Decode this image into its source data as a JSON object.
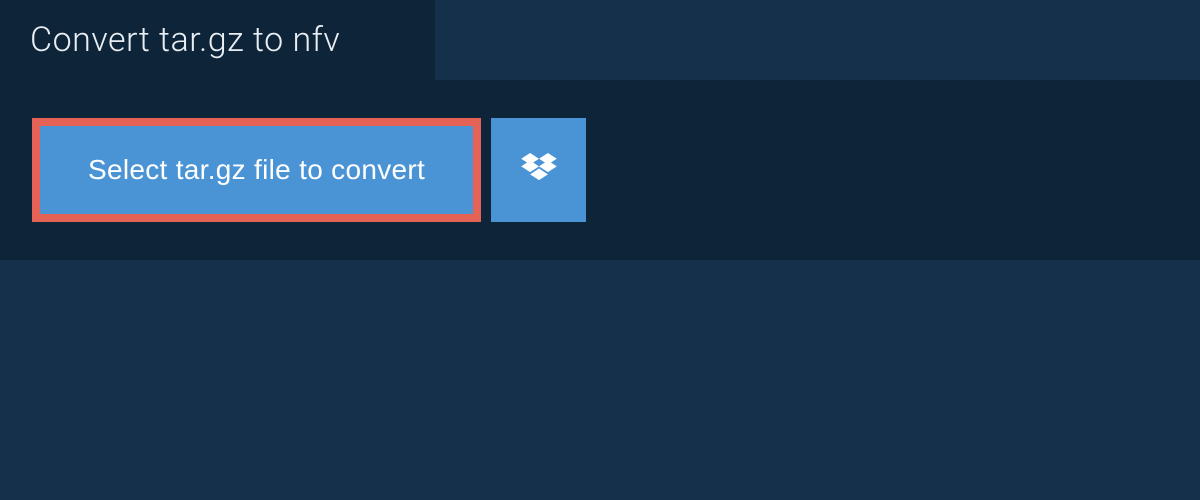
{
  "header": {
    "title": "Convert tar.gz to nfv"
  },
  "actions": {
    "select_file_label": "Select tar.gz file to convert",
    "dropbox_icon_name": "dropbox-icon"
  },
  "colors": {
    "background": "#15304a",
    "panel": "#0e2438",
    "button_primary": "#4a94d6",
    "button_border_highlight": "#e46356",
    "text_light": "#e8eef3"
  }
}
